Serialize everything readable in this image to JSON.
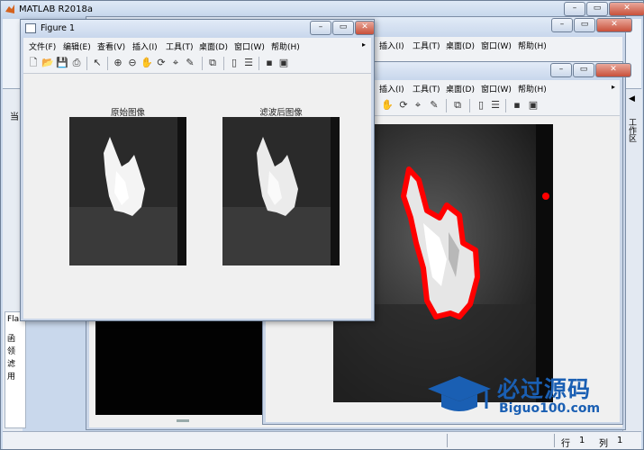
{
  "app": {
    "title": "MATLAB R2018a",
    "left_strip_text": "当",
    "right_panel_label": "工作区",
    "right_panel_arrow": "◀",
    "command_side_chars": [
      "Fla",
      "函",
      "领",
      "滤",
      "用"
    ]
  },
  "status": {
    "row_label": "行",
    "row_value": "1",
    "col_label": "列",
    "col_value": "1"
  },
  "menu": [
    "文件(F)",
    "编辑(E)",
    "查看(V)",
    "插入(I)",
    "工具(T)",
    "桌面(D)",
    "窗口(W)",
    "帮助(H)"
  ],
  "figure1": {
    "title": "Figure 1",
    "left_axes_title": "原始图像",
    "right_axes_title": "滤波后图像"
  },
  "figure2": {
    "menu_visible": [
      "插入(I)",
      "工具(T)",
      "桌面(D)",
      "窗口(W)",
      "帮助(H)"
    ]
  },
  "figure3": {
    "menu_visible": [
      "插入(I)",
      "工具(T)",
      "桌面(D)",
      "窗口(W)",
      "帮助(H)"
    ]
  },
  "toolbar_icons": [
    "new-file-icon",
    "open-folder-icon",
    "save-icon",
    "print-icon",
    "pointer-icon",
    "zoom-in-icon",
    "zoom-out-icon",
    "pan-hand-icon",
    "rotate-icon",
    "data-cursor-icon",
    "brush-icon",
    "link-icon",
    "colorbar-icon",
    "legend-icon",
    "hide-plot-tools-icon",
    "show-plot-tools-icon"
  ],
  "window_buttons": {
    "minimize": "–",
    "maximize": "▭",
    "close": "✕"
  },
  "watermark": {
    "brand": "必过源码",
    "url": "Biguo100.com"
  },
  "colors": {
    "flame": "#ffffff",
    "detection_outline": "#ff0000",
    "watermark_blue": "#1a5fb3"
  }
}
